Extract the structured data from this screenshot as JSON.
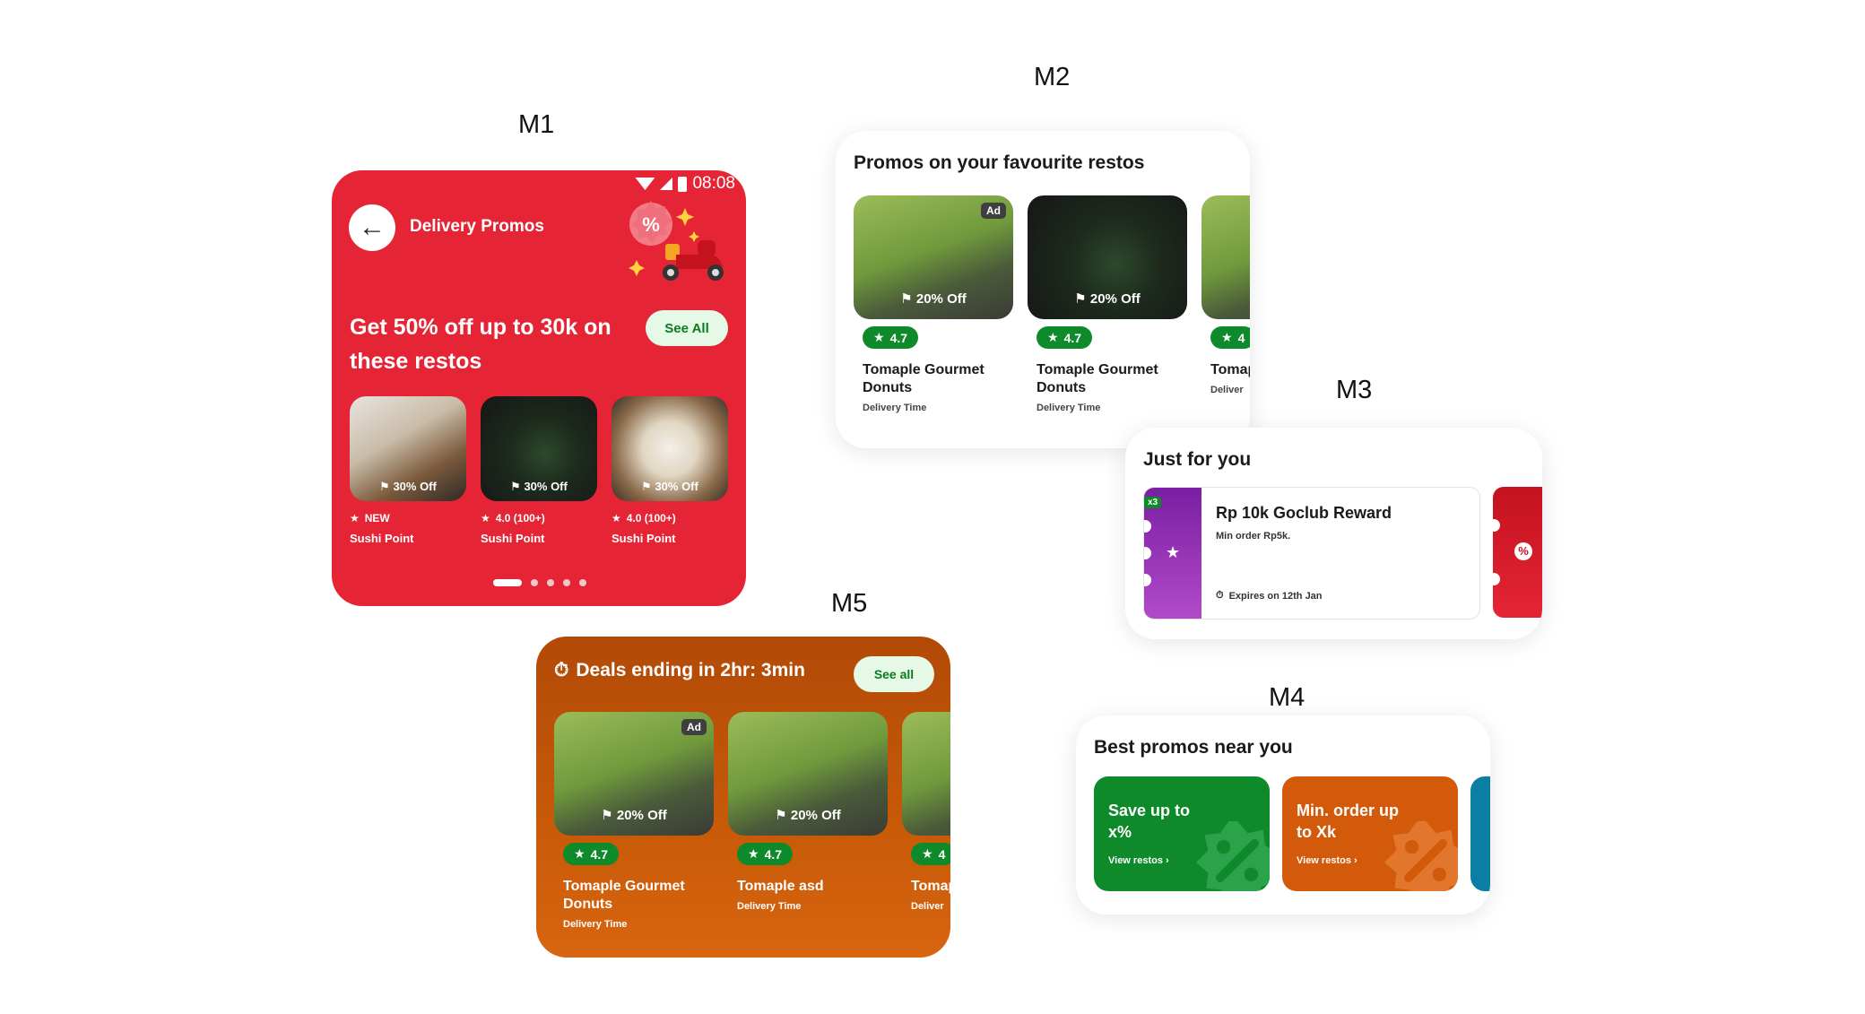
{
  "labels": {
    "m1": "M1",
    "m2": "M2",
    "m3": "M3",
    "m4": "M4",
    "m5": "M5"
  },
  "m1": {
    "status_time": "08:08",
    "header_title": "Delivery Promos",
    "headline": "Get 50% off up to 30k on these restos",
    "see_all": "See All",
    "cards": [
      {
        "discount": "30% Off",
        "rating": "NEW",
        "name": "Sushi Point",
        "image": "platter"
      },
      {
        "discount": "30% Off",
        "rating": "4.0 (100+)",
        "name": "Sushi Point",
        "image": "egg-salad"
      },
      {
        "discount": "30% Off",
        "rating": "4.0 (100+)",
        "name": "Sushi Point",
        "image": "ramen-bowl"
      }
    ],
    "pagination": {
      "count": 5,
      "active": 1
    },
    "colors": {
      "background": "#e52535"
    }
  },
  "m2": {
    "title": "Promos on your favourite restos",
    "cards": [
      {
        "ad": "Ad",
        "discount": "20% Off",
        "rating": "4.7",
        "name": "Tomaple Gourmet Donuts",
        "sub": "Delivery Time"
      },
      {
        "discount": "20% Off",
        "rating": "4.7",
        "name": "Tomaple Gourmet Donuts",
        "sub": "Delivery Time"
      },
      {
        "rating": "4",
        "name": "Tomap Donut",
        "sub": "Deliver"
      }
    ]
  },
  "m3": {
    "title": "Just for you",
    "voucher": {
      "multiplier": "x3",
      "title": "Rp 10k Goclub Reward",
      "min_order": "Min order Rp5k.",
      "expiry": "Expires on 12th Jan"
    }
  },
  "m4": {
    "title": "Best promos near you",
    "tiles": [
      {
        "text": "Save up to x%",
        "link": "View restos",
        "color": "#0e8a2a"
      },
      {
        "text": "Min. order up to Xk",
        "link": "View restos",
        "color": "#d25a0a"
      },
      {
        "text": "",
        "link": "",
        "color": "#0a7fa3"
      }
    ]
  },
  "m5": {
    "title": "Deals ending in 2hr: 3min",
    "see_all": "See all",
    "cards": [
      {
        "ad": "Ad",
        "discount": "20% Off",
        "rating": "4.7",
        "name": "Tomaple Gourmet Donuts",
        "sub": "Delivery Time"
      },
      {
        "discount": "20% Off",
        "rating": "4.7",
        "name": "Tomaple asd",
        "sub": "Delivery Time"
      },
      {
        "rating": "4",
        "name": "Tomap Donut",
        "sub": "Deliver"
      }
    ]
  },
  "icons": {
    "star": "star-icon",
    "discount": "percent-badge-icon",
    "back": "arrow-left-icon",
    "timer": "stopwatch-icon",
    "chevron": "chevron-right-icon"
  }
}
